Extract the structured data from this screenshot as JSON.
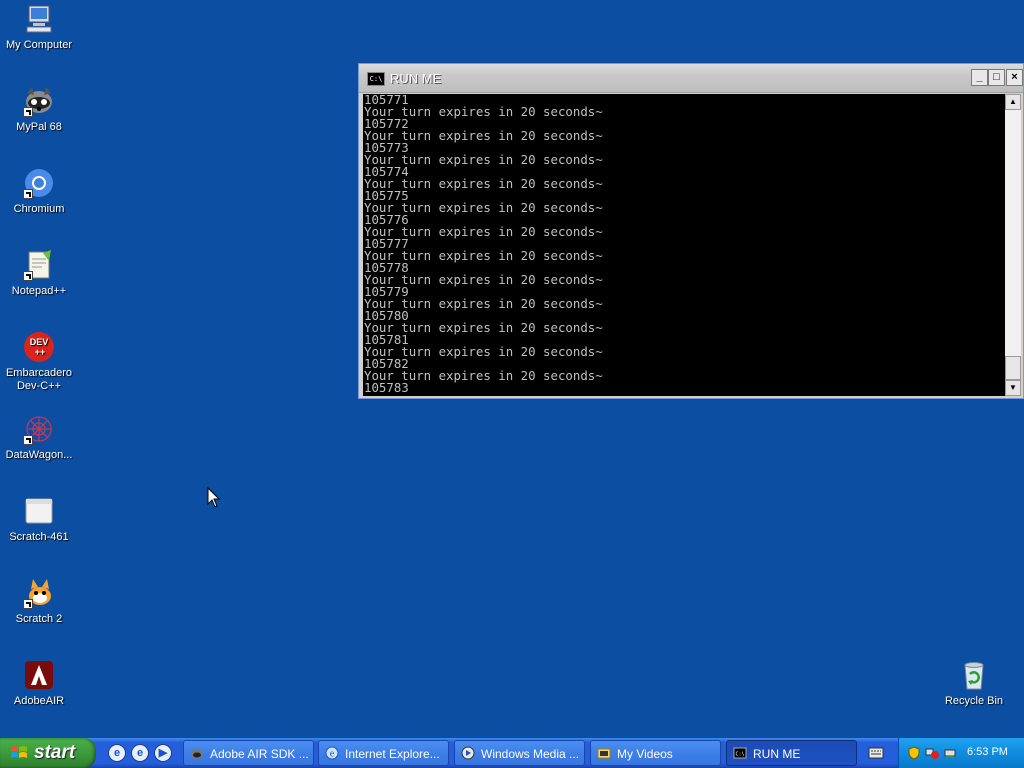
{
  "desktop": {
    "icons": [
      {
        "label": "My Computer",
        "icon": "my-computer-icon"
      },
      {
        "label": "MyPal 68",
        "icon": "mypal-icon"
      },
      {
        "label": "Chromium",
        "icon": "chromium-icon"
      },
      {
        "label": "Notepad++",
        "icon": "notepad-plus-plus-icon"
      },
      {
        "label": "Embarcadero Dev-C++",
        "icon": "dev-cpp-icon"
      },
      {
        "label": "DataWagon...",
        "icon": "datawagon-icon"
      },
      {
        "label": "Scratch-461",
        "icon": "scratch-461-icon"
      },
      {
        "label": "Scratch 2",
        "icon": "scratch-2-icon"
      },
      {
        "label": "AdobeAIR",
        "icon": "adobe-air-icon"
      },
      {
        "label": "Recycle Bin",
        "icon": "recycle-bin-icon"
      }
    ]
  },
  "console": {
    "title": "RUN ME",
    "icon_text": "C:\\",
    "lines": [
      "105771",
      "Your turn expires in 20 seconds~",
      "105772",
      "Your turn expires in 20 seconds~",
      "105773",
      "Your turn expires in 20 seconds~",
      "105774",
      "Your turn expires in 20 seconds~",
      "105775",
      "Your turn expires in 20 seconds~",
      "105776",
      "Your turn expires in 20 seconds~",
      "105777",
      "Your turn expires in 20 seconds~",
      "105778",
      "Your turn expires in 20 seconds~",
      "105779",
      "Your turn expires in 20 seconds~",
      "105780",
      "Your turn expires in 20 seconds~",
      "105781",
      "Your turn expires in 20 seconds~",
      "105782",
      "Your turn expires in 20 seconds~",
      "105783"
    ],
    "buttons": {
      "minimize": "_",
      "maximize": "□",
      "close": "×"
    }
  },
  "taskbar": {
    "start_label": "start",
    "quick_launch": [
      "internet-explorer-icon",
      "ie-alt-icon",
      "windows-media-player-icon"
    ],
    "tasks": [
      {
        "label": "Adobe AIR SDK ...",
        "icon": "adobe-air-sdk-icon",
        "active": false
      },
      {
        "label": "Internet Explore...",
        "icon": "internet-explorer-icon",
        "active": false
      },
      {
        "label": "Windows Media ...",
        "icon": "windows-media-icon",
        "active": false
      },
      {
        "label": "My Videos",
        "icon": "folder-icon",
        "active": false
      },
      {
        "label": "RUN ME",
        "icon": "console-icon",
        "active": true
      }
    ],
    "clock": "6:53 PM"
  },
  "colors": {
    "desktop_bg": "#0b4ea2",
    "taskbar": "#245edb",
    "start_green": "#3c9a3c",
    "console_text": "#c0c0c0"
  }
}
